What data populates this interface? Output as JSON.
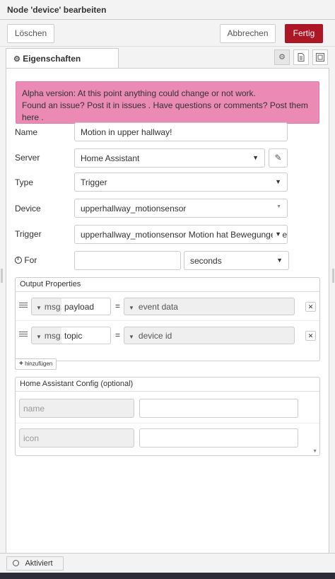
{
  "header": {
    "title": "Node 'device' bearbeiten"
  },
  "toolbar": {
    "delete_label": "Löschen",
    "cancel_label": "Abbrechen",
    "done_label": "Fertig"
  },
  "tabs": {
    "properties_label": "Eigenschaften",
    "icons": [
      "gear-icon",
      "document-icon",
      "appearance-icon"
    ]
  },
  "alert": {
    "line1": "Alpha version: At this point anything could change or not work.",
    "line2_pre": "Found an issue? Post it in",
    "line2_link1": "issues",
    "line2_mid": ". Have questions or comments? Post them",
    "line2_link2": "here",
    "line2_post": "."
  },
  "form": {
    "name_label": "Name",
    "name_value": "Motion in upper hallway!",
    "server_label": "Server",
    "server_value": "Home Assistant",
    "type_label": "Type",
    "type_value": "Trigger",
    "device_label": "Device",
    "device_value": "upperhallway_motionsensor",
    "trigger_label": "Trigger",
    "trigger_value": "upperhallway_motionsensor Motion hat Bewegungen e",
    "for_label": "For",
    "for_value": "",
    "for_unit": "seconds"
  },
  "output_properties": {
    "title": "Output Properties",
    "rows": [
      {
        "prefix": "msg.",
        "property": "payload",
        "equals": "=",
        "value": "event data"
      },
      {
        "prefix": "msg.",
        "property": "topic",
        "equals": "=",
        "value": "device id"
      }
    ],
    "add_label": "hinzufügen",
    "delete_glyph": "✕"
  },
  "ha_config": {
    "title": "Home Assistant Config (optional)",
    "rows": [
      {
        "name_placeholder": "name",
        "value": ""
      },
      {
        "name_placeholder": "icon",
        "value": ""
      }
    ]
  },
  "footer": {
    "toggle_label": "Aktiviert"
  },
  "colors": {
    "primary": "#ad1625",
    "alert_bg": "#ea8ab5"
  }
}
